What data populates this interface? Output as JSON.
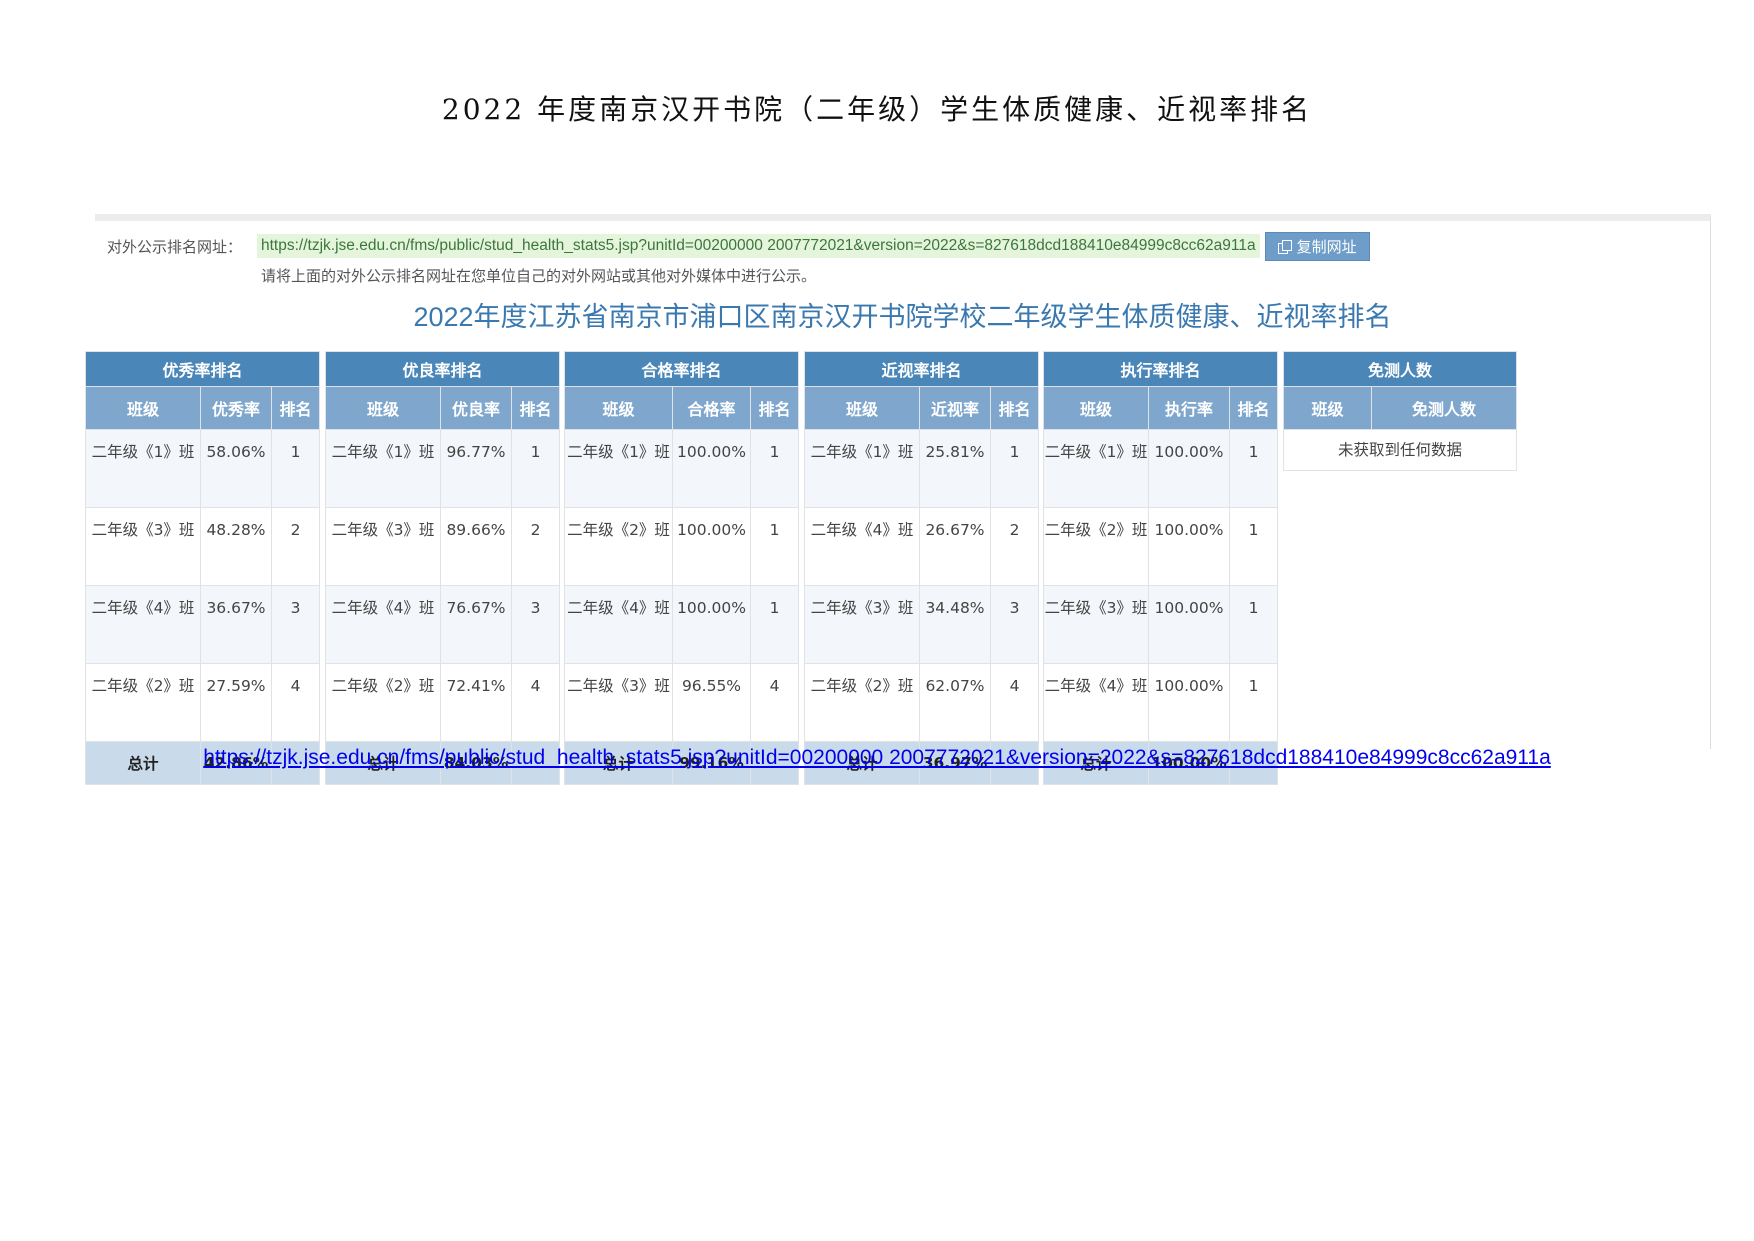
{
  "doc_title": "2022 年度南京汉开书院（二年级）学生体质健康、近视率排名",
  "publish": {
    "label": "对外公示排名网址：",
    "url": "https://tzjk.jse.edu.cn/fms/public/stud_health_stats5.jsp?unitId=00200000 2007772021&version=2022&s=827618dcd188410e84999c8cc62a911a",
    "copy_button": "复制网址",
    "note": "请将上面的对外公示排名网址在您单位自己的对外网站或其他对外媒体中进行公示。"
  },
  "report_title": "2022年度江苏省南京市浦口区南京汉开书院学校二年级学生体质健康、近视率排名",
  "panels": [
    {
      "title": "优秀率排名",
      "headers": [
        "班级",
        "优秀率",
        "排名"
      ],
      "rows": [
        [
          "二年级《1》班",
          "58.06%",
          "1"
        ],
        [
          "二年级《3》班",
          "48.28%",
          "2"
        ],
        [
          "二年级《4》班",
          "36.67%",
          "3"
        ],
        [
          "二年级《2》班",
          "27.59%",
          "4"
        ]
      ],
      "total": [
        "总计",
        "42.86%",
        ""
      ]
    },
    {
      "title": "优良率排名",
      "headers": [
        "班级",
        "优良率",
        "排名"
      ],
      "rows": [
        [
          "二年级《1》班",
          "96.77%",
          "1"
        ],
        [
          "二年级《3》班",
          "89.66%",
          "2"
        ],
        [
          "二年级《4》班",
          "76.67%",
          "3"
        ],
        [
          "二年级《2》班",
          "72.41%",
          "4"
        ]
      ],
      "total": [
        "总计",
        "84.03%",
        ""
      ]
    },
    {
      "title": "合格率排名",
      "headers": [
        "班级",
        "合格率",
        "排名"
      ],
      "rows": [
        [
          "二年级《1》班",
          "100.00%",
          "1"
        ],
        [
          "二年级《2》班",
          "100.00%",
          "1"
        ],
        [
          "二年级《4》班",
          "100.00%",
          "1"
        ],
        [
          "二年级《3》班",
          "96.55%",
          "4"
        ]
      ],
      "total": [
        "总计",
        "99.16%",
        ""
      ]
    },
    {
      "title": "近视率排名",
      "headers": [
        "班级",
        "近视率",
        "排名"
      ],
      "rows": [
        [
          "二年级《1》班",
          "25.81%",
          "1"
        ],
        [
          "二年级《4》班",
          "26.67%",
          "2"
        ],
        [
          "二年级《3》班",
          "34.48%",
          "3"
        ],
        [
          "二年级《2》班",
          "62.07%",
          "4"
        ]
      ],
      "total": [
        "总计",
        "36.97%",
        ""
      ]
    },
    {
      "title": "执行率排名",
      "headers": [
        "班级",
        "执行率",
        "排名"
      ],
      "rows": [
        [
          "二年级《1》班",
          "100.00%",
          "1"
        ],
        [
          "二年级《2》班",
          "100.00%",
          "1"
        ],
        [
          "二年级《3》班",
          "100.00%",
          "1"
        ],
        [
          "二年级《4》班",
          "100.00%",
          "1"
        ]
      ],
      "total": [
        "总计",
        "100.00%",
        ""
      ]
    }
  ],
  "exempt": {
    "title": "免测人数",
    "headers": [
      "班级",
      "免测人数"
    ],
    "empty_text": "未获取到任何数据"
  },
  "footer_link": "https://tzjk.jse.edu.cn/fms/public/stud_health_stats5.jsp?unitId=00200000 2007772021&version=2022&s=827618dcd188410e84999c8cc62a911a",
  "colors": {
    "panel_header": "#4a86b8",
    "sub_header": "#7fa7cd",
    "total_row": "#c9dbea",
    "report_title": "#3a78b0",
    "url_highlight": "#e4f5dc"
  }
}
